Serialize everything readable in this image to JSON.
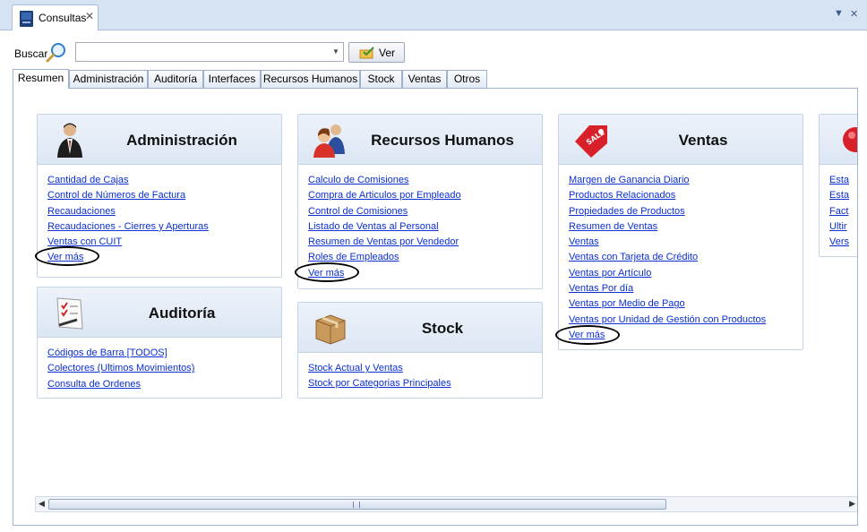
{
  "window": {
    "tab_title": "Consultas",
    "close_glyph": "✕",
    "menu_glyph": "▼",
    "close_window_glyph": "✕"
  },
  "search": {
    "label": "Buscar",
    "value": "",
    "button_label": "Ver"
  },
  "tabs": [
    "Resumen",
    "Administración",
    "Auditoría",
    "Interfaces",
    "Recursos Humanos",
    "Stock",
    "Ventas",
    "Otros"
  ],
  "active_tab": "Resumen",
  "cards": {
    "administracion": {
      "title": "Administración",
      "icon": "businessman-icon",
      "links": [
        "Cantidad de Cajas",
        "Control de Números de Factura",
        "Recaudaciones",
        "Recaudaciones - Cierres y Aperturas",
        "Ventas con CUIT",
        "Ver más"
      ]
    },
    "auditoria": {
      "title": "Auditoría",
      "icon": "checklist-icon",
      "links": [
        "Códigos de Barra [TODOS]",
        "Colectores (Ultimos Movimientos)",
        "Consulta de Ordenes"
      ]
    },
    "recursos_humanos": {
      "title": "Recursos Humanos",
      "icon": "people-icon",
      "links": [
        "Calculo de Comisiones",
        "Compra de Articulos por Empleado",
        "Control de Comisiones",
        "Listado de Ventas al Personal",
        "Resumen de Ventas por Vendedor",
        "Roles de Empleados",
        "Ver más"
      ]
    },
    "stock": {
      "title": "Stock",
      "icon": "box-icon",
      "links": [
        "Stock Actual y Ventas",
        "Stock por Categorias Principales"
      ]
    },
    "ventas": {
      "title": "Ventas",
      "icon": "sale-tag-icon",
      "icon_text": "SALE",
      "links": [
        "Margen de Ganancia Diario",
        "Productos Relacionados",
        "Propiedades de Productos",
        "Resumen de Ventas",
        "Ventas",
        "Ventas con Tarjeta de Crédito",
        "Ventas por Artículo",
        "Ventas Por día",
        "Ventas por Medio de Pago",
        "Ventas por Unidad de Gestión con Productos",
        "Ver más"
      ]
    },
    "otros_partial": {
      "icon": "red-circle-icon",
      "links": [
        "Esta",
        "Esta",
        "Fact",
        "Ultir",
        "Vers"
      ]
    }
  },
  "colors": {
    "link": "#0b2fd1",
    "card_header": "#dce7f4",
    "window_bg": "#d9e4f3"
  }
}
